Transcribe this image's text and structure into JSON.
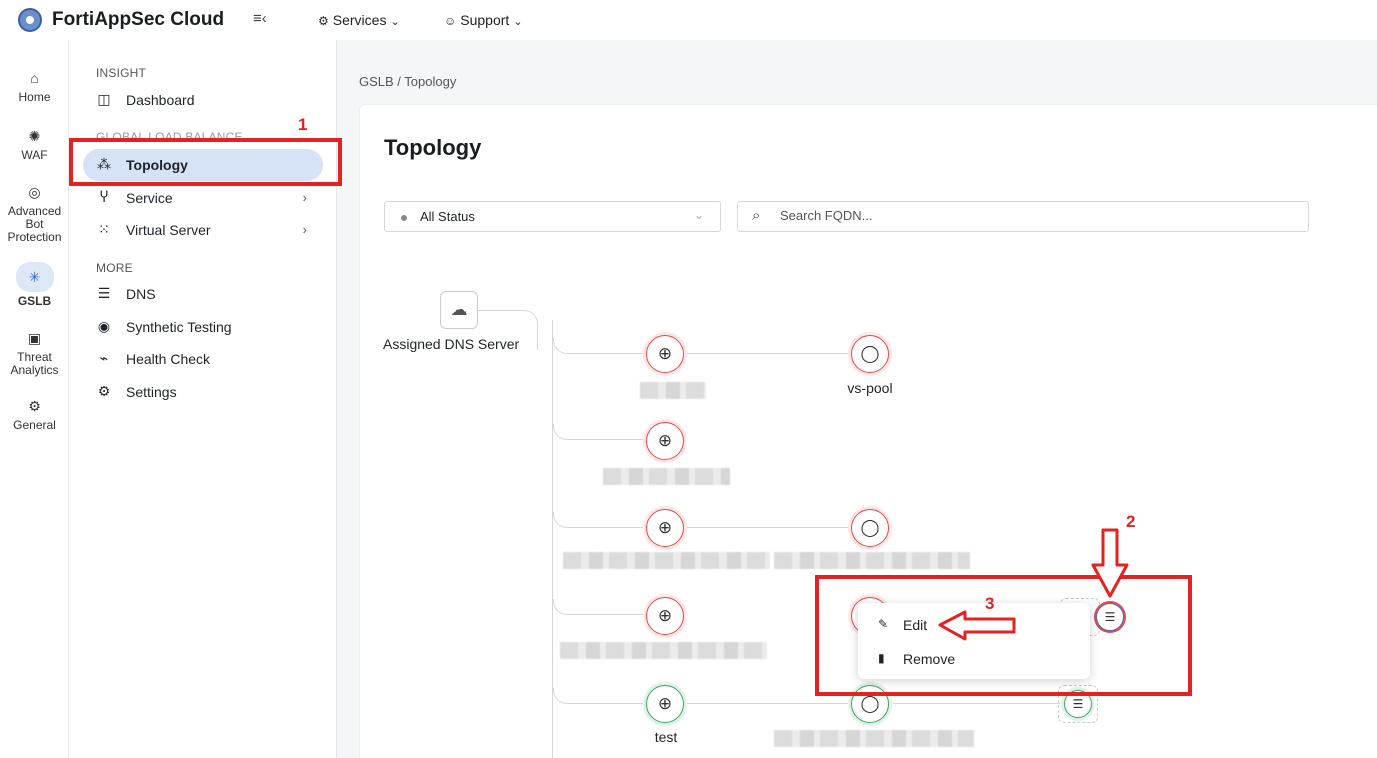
{
  "app": {
    "brand": "FortiAppSec Cloud",
    "collapse_icon": "collapse-menu-icon",
    "nav": [
      {
        "label": "Services",
        "icon": "services-icon"
      },
      {
        "label": "Support",
        "icon": "support-icon"
      }
    ]
  },
  "rail": [
    {
      "label": "Home",
      "icon": "home-icon"
    },
    {
      "label": "WAF",
      "icon": "waf-icon"
    },
    {
      "label": "Advanced Bot Protection",
      "icon": "bot-icon"
    },
    {
      "label": "GSLB",
      "icon": "gslb-icon",
      "active": true
    },
    {
      "label": "Threat Analytics",
      "icon": "analytics-icon"
    },
    {
      "label": "General",
      "icon": "general-icon"
    }
  ],
  "sidebar": {
    "insight_title": "INSIGHT",
    "global_title": "GLOBAL LOAD BALANCE",
    "more_title": "MORE",
    "items": [
      {
        "label": "Dashboard",
        "icon": "dashboard-icon"
      },
      {
        "label": "Topology",
        "icon": "topology-icon",
        "active": true
      },
      {
        "label": "Service",
        "icon": "service-icon",
        "chevron": "›"
      },
      {
        "label": "Virtual Server",
        "icon": "virtual-server-icon",
        "chevron": "›"
      },
      {
        "label": "DNS",
        "icon": "dns-icon"
      },
      {
        "label": "Synthetic Testing",
        "icon": "synthetic-testing-icon"
      },
      {
        "label": "Health Check",
        "icon": "health-check-icon"
      },
      {
        "label": "Settings",
        "icon": "settings-icon"
      }
    ]
  },
  "main": {
    "breadcrumb": "GSLB / Topology",
    "title": "Topology",
    "status_filter": "All Status",
    "search_placeholder": "Search FQDN..."
  },
  "topology": {
    "root_label": "Assigned DNS Server",
    "pool_label": "vs-pool",
    "test_label": "test",
    "status_colors": {
      "down": "#e04b4b",
      "up": "#3aa460"
    }
  },
  "context_menu": {
    "edit": "Edit",
    "remove": "Remove"
  },
  "annotations": {
    "n1": "1",
    "n2": "2",
    "n3": "3",
    "color": "#e32222"
  }
}
